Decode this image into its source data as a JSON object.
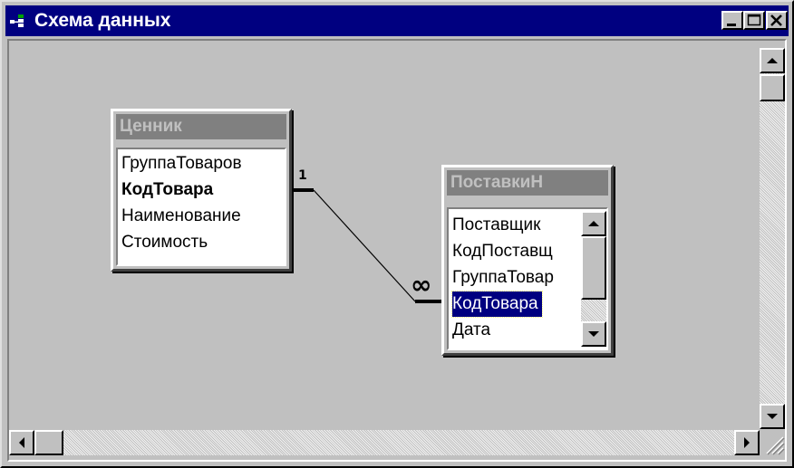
{
  "window": {
    "title": "Схема данных",
    "buttons": {
      "minimize": "minimize",
      "maximize": "maximize",
      "close": "close"
    }
  },
  "tables": [
    {
      "name": "Ценник",
      "fields": [
        {
          "label": "ГруппаТоваров",
          "key": false
        },
        {
          "label": "КодТовара",
          "key": true
        },
        {
          "label": "Наименование",
          "key": false
        },
        {
          "label": "Стоимость",
          "key": false
        }
      ]
    },
    {
      "name": "ПоставкиН",
      "fields": [
        {
          "label": "Поставщик",
          "selected": false
        },
        {
          "label": "КодПоставщ",
          "selected": false
        },
        {
          "label": "ГруппаТовар",
          "selected": false
        },
        {
          "label": "КодТовара",
          "selected": true
        },
        {
          "label": "Дата",
          "selected": false
        }
      ]
    }
  ],
  "relationship": {
    "from_table": "Ценник",
    "from_field": "КодТовара",
    "to_table": "ПоставкиН",
    "to_field": "КодТовара",
    "one_label": "1",
    "many_label": "∞"
  },
  "icons": {
    "window": "relationships-icon",
    "scroll_up": "arrow-up-icon",
    "scroll_down": "arrow-down-icon",
    "scroll_left": "arrow-left-icon",
    "scroll_right": "arrow-right-icon",
    "size_grip": "size-grip-icon"
  },
  "colors": {
    "titlebar": "#000080",
    "face": "#c0c0c0",
    "selection": "#000080"
  }
}
